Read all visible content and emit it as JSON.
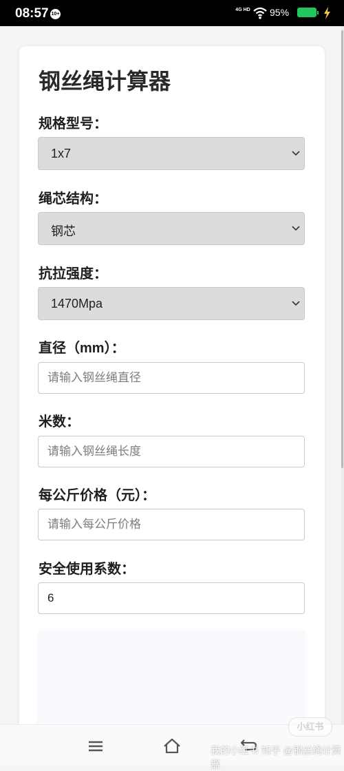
{
  "status_bar": {
    "time": "08:57",
    "badge": "10+",
    "network": "4G HD",
    "battery": "95%"
  },
  "colors": {
    "battery": "#22c65e",
    "select_background": "#dcdcdc"
  },
  "calculator": {
    "title": "钢丝绳计算器",
    "spec": {
      "label": "规格型号：",
      "value": "1x7"
    },
    "core": {
      "label": "绳芯结构：",
      "value": "钢芯"
    },
    "strength": {
      "label": "抗拉强度：",
      "value": "1470Mpa"
    },
    "diameter": {
      "label": "直径（mm）：",
      "placeholder": "请输入钢丝绳直径",
      "value": ""
    },
    "length": {
      "label": "米数：",
      "placeholder": "请输入钢丝绳长度",
      "value": ""
    },
    "price": {
      "label": "每公斤价格（元）：",
      "placeholder": "请输入每公斤价格",
      "value": ""
    },
    "safety": {
      "label": "安全使用系数：",
      "value": "6"
    }
  },
  "icons": {
    "dropdown": "chevron-down-icon",
    "nav": [
      "menu-icon",
      "home-icon",
      "back-icon"
    ]
  },
  "watermark": {
    "text": "我的小红书 知乎 @钢丝绳计算器",
    "logo": "小红书"
  }
}
